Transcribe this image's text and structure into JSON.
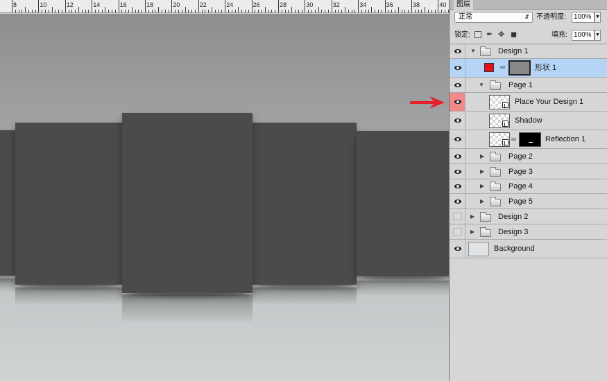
{
  "ruler": {
    "labels": [
      "8",
      "10",
      "12",
      "14",
      "16",
      "18",
      "20",
      "22",
      "24",
      "26",
      "28",
      "30",
      "32",
      "34",
      "36",
      "38",
      "40"
    ]
  },
  "panel": {
    "tab_label": "图层",
    "blend_mode": "正常",
    "opacity_label": "不透明度:",
    "opacity_value": "100%",
    "lock_label": "锁定:",
    "fill_label": "填充:",
    "fill_value": "100%"
  },
  "layers": [
    {
      "label": "Design 1",
      "visible": true
    },
    {
      "label": "形状 1",
      "visible": true,
      "selected": true,
      "swatch_color": "#e4101c"
    },
    {
      "label": "Page 1",
      "visible": true
    },
    {
      "label": "Place Your Design 1",
      "visible": true,
      "highlighted": true
    },
    {
      "label": "Shadow",
      "visible": true
    },
    {
      "label": "Reflection 1",
      "visible": true
    },
    {
      "label": "Page 2",
      "visible": true
    },
    {
      "label": "Page 3",
      "visible": true
    },
    {
      "label": "Page 4",
      "visible": true
    },
    {
      "label": "Page 5",
      "visible": true
    },
    {
      "label": "Design 2",
      "visible": false
    },
    {
      "label": "Design 3",
      "visible": false
    },
    {
      "label": "Background",
      "visible": true
    }
  ],
  "colors": {
    "arrow": "#e5202a",
    "selected_row": "#b5d4f5",
    "highlight_eye": "#f08a8a"
  }
}
